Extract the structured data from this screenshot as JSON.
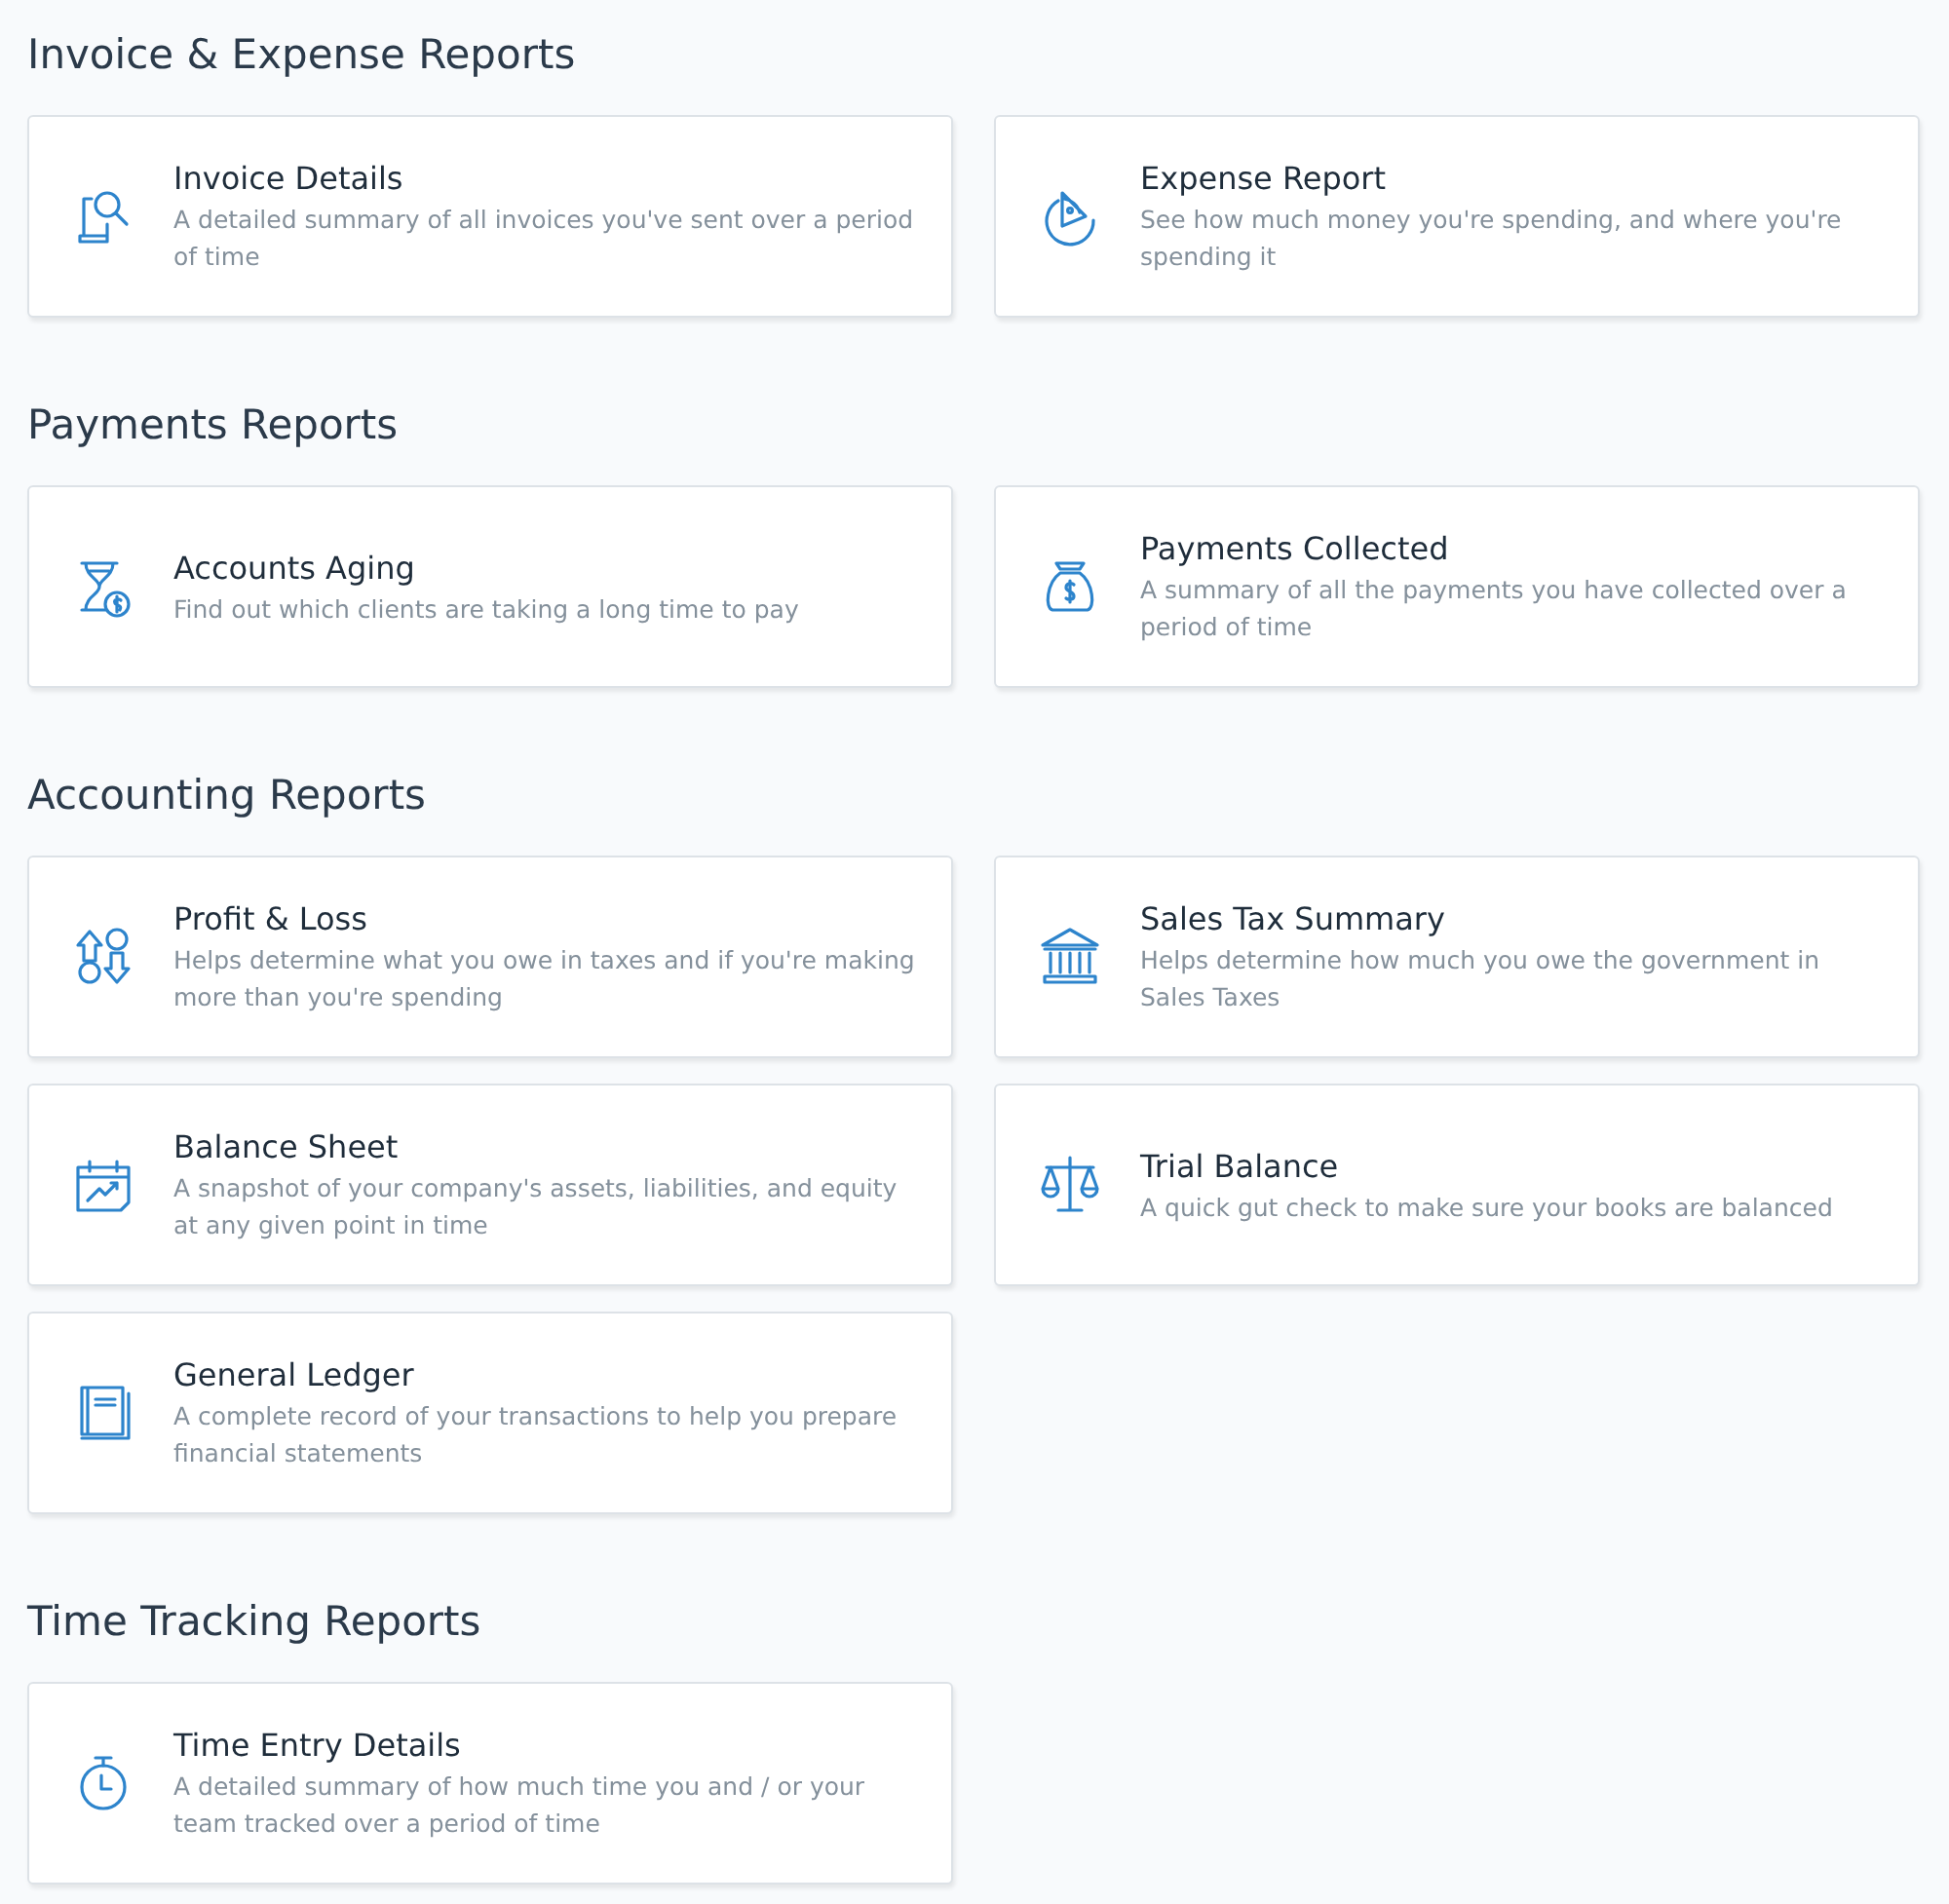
{
  "sections": [
    {
      "heading": "Invoice & Expense Reports",
      "cards": [
        {
          "title": "Invoice Details",
          "description": "A detailed summary of all invoices you've sent over a period of time"
        },
        {
          "title": "Expense Report",
          "description": "See how much money you're spending, and where you're spending it"
        }
      ]
    },
    {
      "heading": "Payments Reports",
      "cards": [
        {
          "title": "Accounts Aging",
          "description": "Find out which clients are taking a long time to pay"
        },
        {
          "title": "Payments Collected",
          "description": "A summary of all the payments you have collected over a period of time"
        }
      ]
    },
    {
      "heading": "Accounting Reports",
      "cards": [
        {
          "title": "Profit & Loss",
          "description": "Helps determine what you owe in taxes and if you're making more than you're spending"
        },
        {
          "title": "Sales Tax Summary",
          "description": "Helps determine how much you owe the government in Sales Taxes"
        },
        {
          "title": "Balance Sheet",
          "description": "A snapshot of your company's assets, liabilities, and equity at any given point in time"
        },
        {
          "title": "Trial Balance",
          "description": "A quick gut check to make sure your books are balanced"
        },
        {
          "title": "General Ledger",
          "description": "A complete record of your transactions to help you prepare financial statements"
        }
      ]
    },
    {
      "heading": "Time Tracking Reports",
      "cards": [
        {
          "title": "Time Entry Details",
          "description": "A detailed summary of how much time you and / or your team tracked over a period of time"
        }
      ]
    }
  ]
}
